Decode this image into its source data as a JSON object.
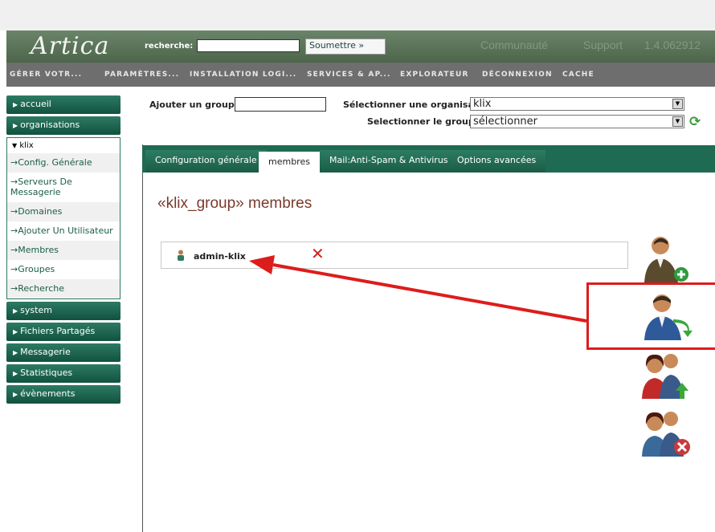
{
  "header": {
    "logo": "Artica",
    "search_label": "recherche:",
    "search_value": "",
    "submit_label": "Soumettre »",
    "links": [
      "Communauté",
      "Support",
      "1.4.062912"
    ]
  },
  "nav": [
    "GÉRER VOTR...",
    "PARAMÈTRES...",
    "INSTALLATION LOGI...",
    "SERVICES & AP...",
    "EXPLORATEUR",
    "DÉCONNEXION",
    "CACHE"
  ],
  "sidebar": {
    "top": [
      "accueil",
      "organisations"
    ],
    "org": "klix",
    "org_items": [
      "Config. Générale",
      "Serveurs De Messagerie",
      "Domaines",
      "Ajouter Un Utilisateur",
      "Membres",
      "Groupes",
      "Recherche"
    ],
    "bottom": [
      "system",
      "Fichiers Partagés",
      "Messagerie",
      "Statistiques",
      "évènements"
    ]
  },
  "form": {
    "add_group_label": "Ajouter un groupe:",
    "add_group_value": "",
    "select_org_label": "Sélectionner une organisation:",
    "select_org_value": "klix",
    "select_group_label": "Selectionner le groupe:",
    "select_group_value": "sélectionner"
  },
  "tabs": [
    "Configuration générale",
    "membres",
    "Mail:Anti-Spam & Antivirus",
    "Options avancées"
  ],
  "content": {
    "title": "«klix_group» membres",
    "members": [
      "admin-klix"
    ]
  },
  "colors": {
    "accent_green": "#1f6a52",
    "title_brown": "#7a3a2a",
    "highlight_red": "#dd1c1c"
  }
}
